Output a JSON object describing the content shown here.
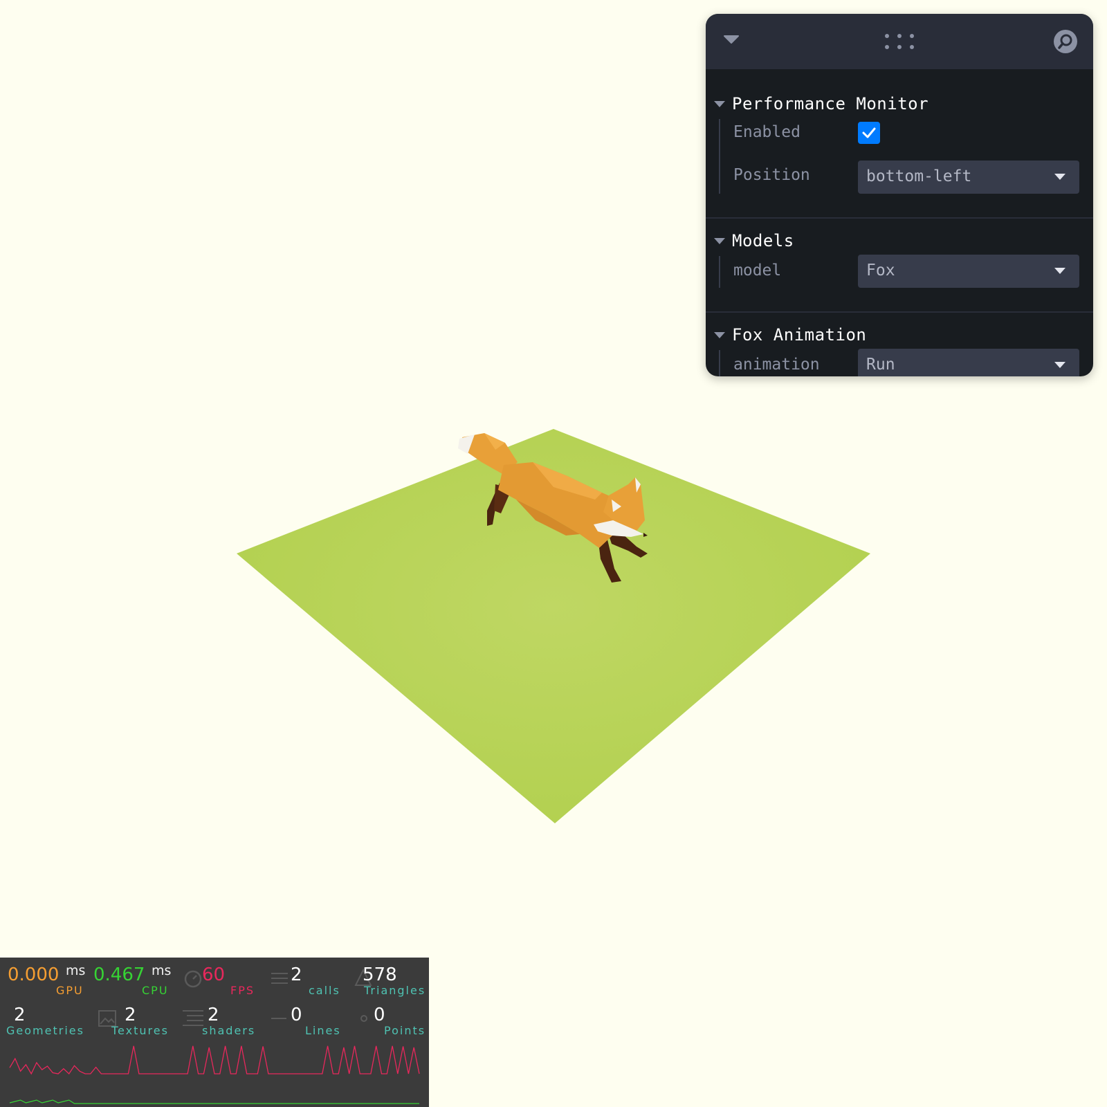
{
  "panel": {
    "sections": [
      {
        "title": "Performance Monitor",
        "rows": [
          {
            "label": "Enabled",
            "type": "checkbox",
            "checked": true
          },
          {
            "label": "Position",
            "type": "select",
            "value": "bottom-left"
          }
        ]
      },
      {
        "title": "Models",
        "rows": [
          {
            "label": "model",
            "type": "select",
            "value": "Fox"
          }
        ]
      },
      {
        "title": "Fox Animation",
        "rows": [
          {
            "label": "animation",
            "type": "select",
            "value": "Run"
          }
        ]
      }
    ],
    "icons": {
      "collapse": "chevron-down-icon",
      "drag": "drag-handle-icon",
      "search": "search-icon"
    }
  },
  "perf": {
    "gpu": {
      "value": "0.000",
      "unit": "ms",
      "label": "GPU",
      "color": "#f59e32"
    },
    "cpu": {
      "value": "0.467",
      "unit": "ms",
      "label": "CPU",
      "color": "#36d334"
    },
    "fps": {
      "value": "60",
      "label": "FPS",
      "color": "#e8285c"
    },
    "calls": {
      "value": "2",
      "label": "calls"
    },
    "triangles": {
      "value": "578",
      "label": "Triangles"
    },
    "geometries": {
      "value": "2",
      "label": "Geometries"
    },
    "textures": {
      "value": "2",
      "label": "Textures"
    },
    "shaders": {
      "value": "2",
      "label": "shaders"
    },
    "lines": {
      "value": "0",
      "label": "Lines"
    },
    "points": {
      "value": "0",
      "label": "Points"
    },
    "label_color": "#4fc3b3",
    "fps_history": [
      48,
      30,
      55,
      42,
      60,
      38,
      52,
      45,
      58,
      60,
      50,
      60,
      44,
      55,
      60,
      60,
      47,
      60,
      60,
      60,
      60,
      60,
      60,
      5,
      60,
      60,
      60,
      60,
      60,
      60,
      60,
      60,
      60,
      60,
      5,
      60,
      60,
      8,
      60,
      60,
      5,
      60,
      60,
      5,
      60,
      60,
      60,
      6,
      60,
      60,
      60,
      60,
      60,
      60,
      60,
      60,
      60,
      60,
      60,
      5,
      60,
      60,
      8,
      60,
      5,
      60,
      60,
      60,
      5,
      60,
      60,
      5,
      60,
      6,
      60,
      8,
      60
    ]
  },
  "scene": {
    "background_color": "#fefef0",
    "ground_color": "#b8d45a",
    "model": "fox"
  }
}
